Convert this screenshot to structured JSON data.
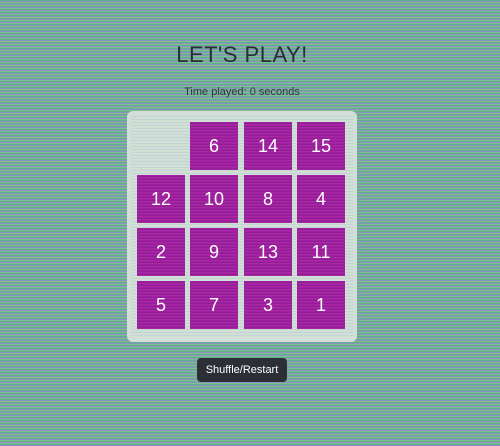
{
  "header": {
    "title": "LET'S PLAY!",
    "timer_text": "Time played: 0 seconds"
  },
  "board": {
    "rows": [
      [
        "",
        "6",
        "14",
        "15"
      ],
      [
        "12",
        "10",
        "8",
        "4"
      ],
      [
        "2",
        "9",
        "13",
        "11"
      ],
      [
        "5",
        "7",
        "3",
        "1"
      ]
    ]
  },
  "controls": {
    "shuffle_label": "Shuffle/Restart"
  },
  "colors": {
    "tile": "#a020a0",
    "board_frame": "#d2ded7",
    "button": "#2c2f36"
  }
}
